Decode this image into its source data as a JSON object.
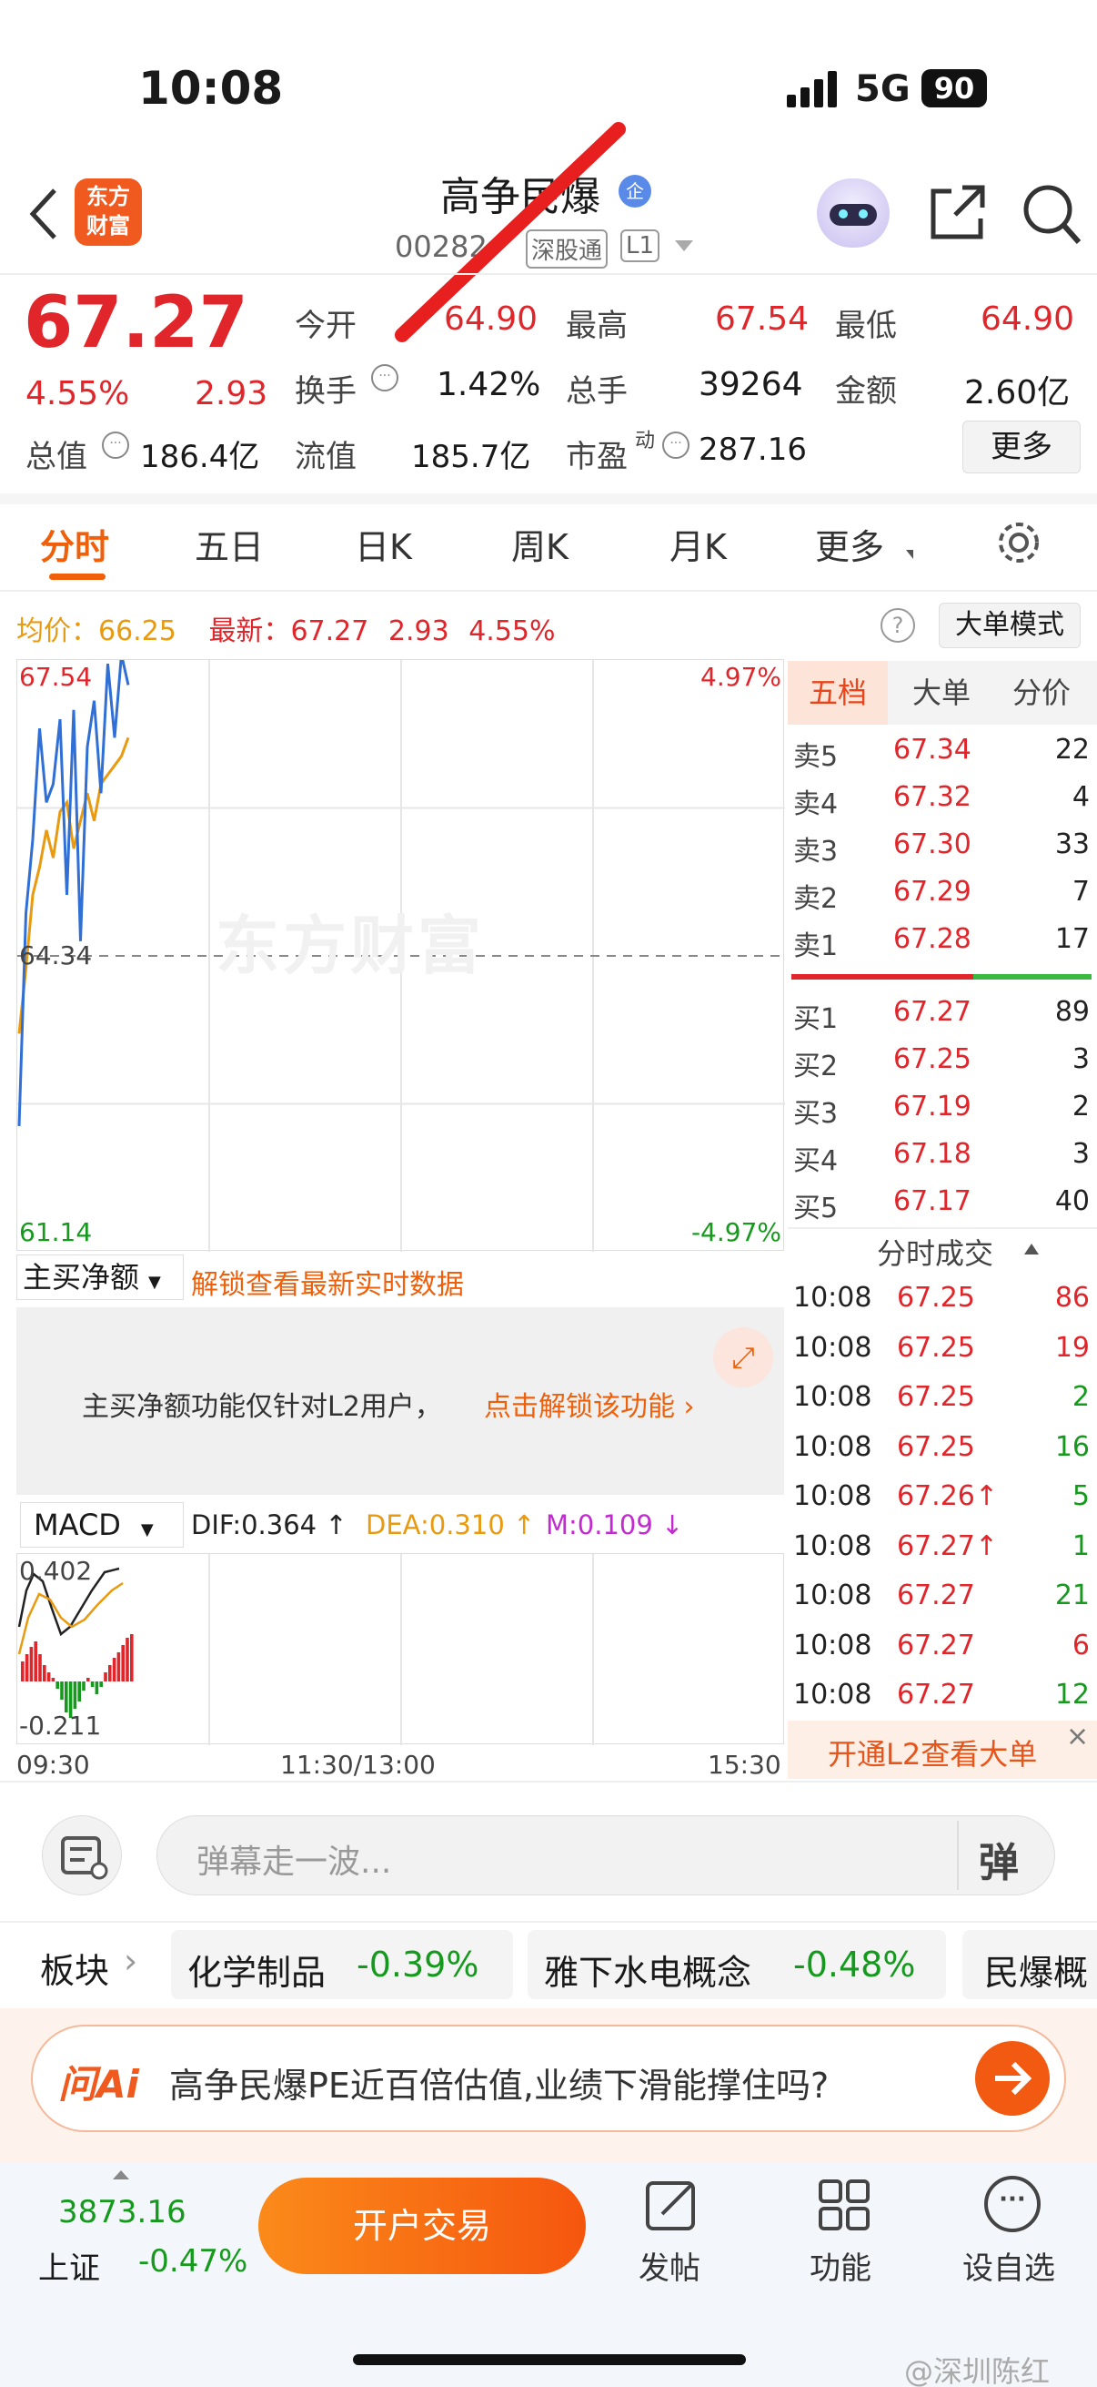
{
  "status": {
    "time": "10:08",
    "network": "5G",
    "battery": "90"
  },
  "header": {
    "title": "高争民爆",
    "badge": "企",
    "code": "00282",
    "market": "深股通",
    "level": "L1",
    "logo_top": "东方",
    "logo_bottom": "财富"
  },
  "quote": {
    "price": "67.27",
    "pct": "4.55%",
    "chg": "2.93",
    "open_label": "今开",
    "open": "64.90",
    "high_label": "最高",
    "high": "67.54",
    "low_label": "最低",
    "low": "64.90",
    "turn_label": "换手",
    "turn": "1.42%",
    "vol_label": "总手",
    "vol": "39264",
    "amt_label": "金额",
    "amt": "2.60亿",
    "mcap_label": "总值",
    "mcap": "186.4亿",
    "float_label": "流值",
    "float": "185.7亿",
    "pe_label": "市盈",
    "pe_sup": "动",
    "pe": "287.16",
    "more": "更多"
  },
  "tabs": [
    "分时",
    "五日",
    "日K",
    "周K",
    "月K",
    "更多"
  ],
  "info": {
    "avg_label": "均价：",
    "avg": "66.25",
    "latest_label": "最新：",
    "latest": "67.27",
    "chg": "2.93",
    "pct": "4.55%",
    "mode": "大单模式"
  },
  "chart": {
    "top": "67.54",
    "mid": "64.34",
    "bottom": "61.14",
    "top_pct": "4.97%",
    "bottom_pct": "-4.97%",
    "watermark": "东方财富",
    "times": [
      "09:30",
      "11:30/13:00",
      "15:30"
    ]
  },
  "chart_data": {
    "type": "line",
    "series": [
      {
        "values": [
          63.5,
          64.2,
          65.0,
          65.3,
          65.7,
          65.4,
          65.9,
          66.0,
          65.5,
          65.8,
          66.1,
          65.8,
          66.2,
          66.3,
          66.4,
          66.5,
          66.7
        ]
      },
      {
        "values": [
          62.5,
          64.8,
          65.6,
          66.8,
          66.0,
          66.2,
          66.9,
          65.0,
          67.0,
          64.5,
          66.6,
          67.1,
          66.1,
          67.5,
          66.7,
          67.6,
          67.27
        ]
      }
    ],
    "ylim": [
      61.14,
      67.54
    ]
  },
  "netbuy": {
    "label": "主买净额",
    "unlock": "解锁查看最新实时数据",
    "note": "主买净额功能仅针对L2用户，",
    "cta": "点击解锁该功能"
  },
  "macd": {
    "label": "MACD",
    "dif": "DIF:0.364 ↑",
    "dea": "DEA:0.310 ↑",
    "m": "M:0.109 ↓",
    "top": "0.402",
    "bottom": "-0.211"
  },
  "book": {
    "tabs": [
      "五档",
      "大单",
      "分价"
    ],
    "asks": [
      {
        "l": "卖5",
        "p": "67.34",
        "v": "22"
      },
      {
        "l": "卖4",
        "p": "67.32",
        "v": "4"
      },
      {
        "l": "卖3",
        "p": "67.30",
        "v": "33"
      },
      {
        "l": "卖2",
        "p": "67.29",
        "v": "7"
      },
      {
        "l": "卖1",
        "p": "67.28",
        "v": "17"
      }
    ],
    "bids": [
      {
        "l": "买1",
        "p": "67.27",
        "v": "89"
      },
      {
        "l": "买2",
        "p": "67.25",
        "v": "3"
      },
      {
        "l": "买3",
        "p": "67.19",
        "v": "2"
      },
      {
        "l": "买4",
        "p": "67.18",
        "v": "3"
      },
      {
        "l": "买5",
        "p": "67.17",
        "v": "40"
      }
    ],
    "trades_title": "分时成交",
    "trades": [
      {
        "t": "10:08",
        "p": "67.25",
        "v": "86",
        "c": "red"
      },
      {
        "t": "10:08",
        "p": "67.25",
        "v": "19",
        "c": "red"
      },
      {
        "t": "10:08",
        "p": "67.25",
        "v": "2",
        "c": "green"
      },
      {
        "t": "10:08",
        "p": "67.25",
        "v": "16",
        "c": "green"
      },
      {
        "t": "10:08",
        "p": "67.26↑",
        "v": "5",
        "c": "green"
      },
      {
        "t": "10:08",
        "p": "67.27↑",
        "v": "1",
        "c": "green"
      },
      {
        "t": "10:08",
        "p": "67.27",
        "v": "21",
        "c": "green"
      },
      {
        "t": "10:08",
        "p": "67.27",
        "v": "6",
        "c": "red"
      },
      {
        "t": "10:08",
        "p": "67.27",
        "v": "12",
        "c": "green"
      }
    ],
    "l2": "开通L2查看大单"
  },
  "danmu": {
    "placeholder": "弹幕走一波...",
    "btn": "弹"
  },
  "sectors": {
    "label": "板块",
    "items": [
      {
        "n": "化学制品",
        "p": "-0.39%"
      },
      {
        "n": "雅下水电概念",
        "p": "-0.48%"
      },
      {
        "n": "民爆概"
      }
    ]
  },
  "ai": {
    "brand": "问Ai",
    "q": "高争民爆PE近百倍估值,业绩下滑能撑住吗?"
  },
  "bottom": {
    "index_val": "3873.16",
    "index_name": "上证",
    "index_pct": "-0.47%",
    "trade": "开户交易",
    "post": "发帖",
    "func": "功能",
    "fav": "设自选"
  },
  "watermark": "@深圳陈红"
}
